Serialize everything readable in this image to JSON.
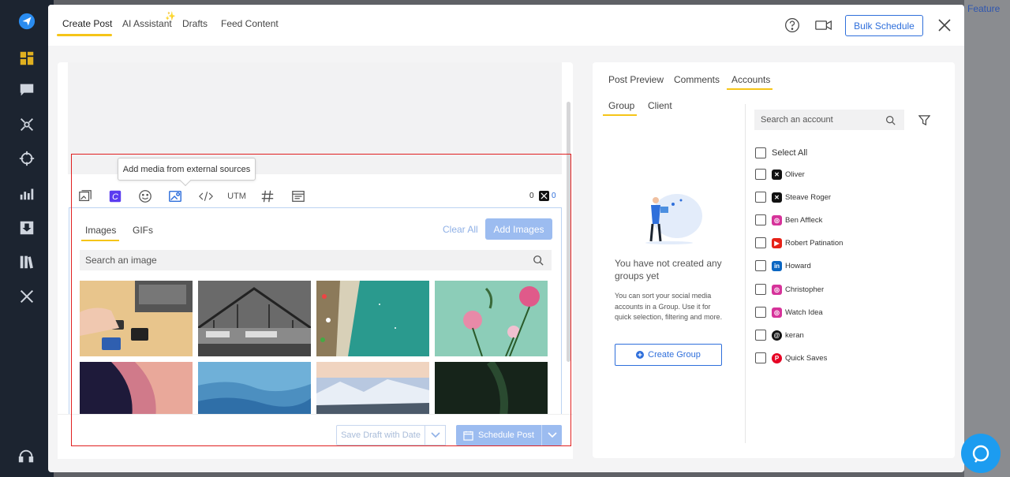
{
  "header": {
    "tabs": [
      {
        "label": "Create Post"
      },
      {
        "label": "AI Assistant"
      },
      {
        "label": "Drafts"
      },
      {
        "label": "Feed Content"
      }
    ],
    "bulk_schedule_label": "Bulk Schedule"
  },
  "background": {
    "feature_text": "w Feature"
  },
  "editor": {
    "tooltip": "Add media from external sources",
    "tools": {
      "utm": "UTM"
    },
    "counts": {
      "general": "0",
      "x": "0"
    },
    "media": {
      "tabs": [
        {
          "label": "Images"
        },
        {
          "label": "GIFs"
        }
      ],
      "clear_all": "Clear All",
      "add_images": "Add Images",
      "search_placeholder": "Search an image"
    },
    "footer": {
      "save_draft": "Save Draft with Date",
      "schedule_post": "Schedule Post"
    }
  },
  "preview": {
    "tabs": [
      {
        "label": "Post Preview"
      },
      {
        "label": "Comments"
      },
      {
        "label": "Accounts"
      }
    ],
    "subtabs": [
      {
        "label": "Group"
      },
      {
        "label": "Client"
      }
    ],
    "empty_title": "You have not created any groups yet",
    "empty_desc": "You can sort your social media accounts in a Group. Use it for quick selection, filtering and more.",
    "create_group": "Create Group",
    "search_placeholder": "Search an account",
    "select_all": "Select All",
    "accounts": [
      {
        "name": "Oliver",
        "network": "x"
      },
      {
        "name": "Steave Roger",
        "network": "x"
      },
      {
        "name": "Ben Affleck",
        "network": "instagram"
      },
      {
        "name": "Robert Patination",
        "network": "youtube"
      },
      {
        "name": "Howard",
        "network": "linkedin"
      },
      {
        "name": "Christopher",
        "network": "instagram"
      },
      {
        "name": "Watch Idea",
        "network": "instagram"
      },
      {
        "name": "keran",
        "network": "threads"
      },
      {
        "name": "Quick Saves",
        "network": "pinterest"
      }
    ]
  },
  "colors": {
    "accent_yellow": "#f5c518",
    "primary_blue": "#2f6fdb",
    "disabled_blue": "#9cbcf0",
    "sidebar_dark": "#1c2430"
  }
}
